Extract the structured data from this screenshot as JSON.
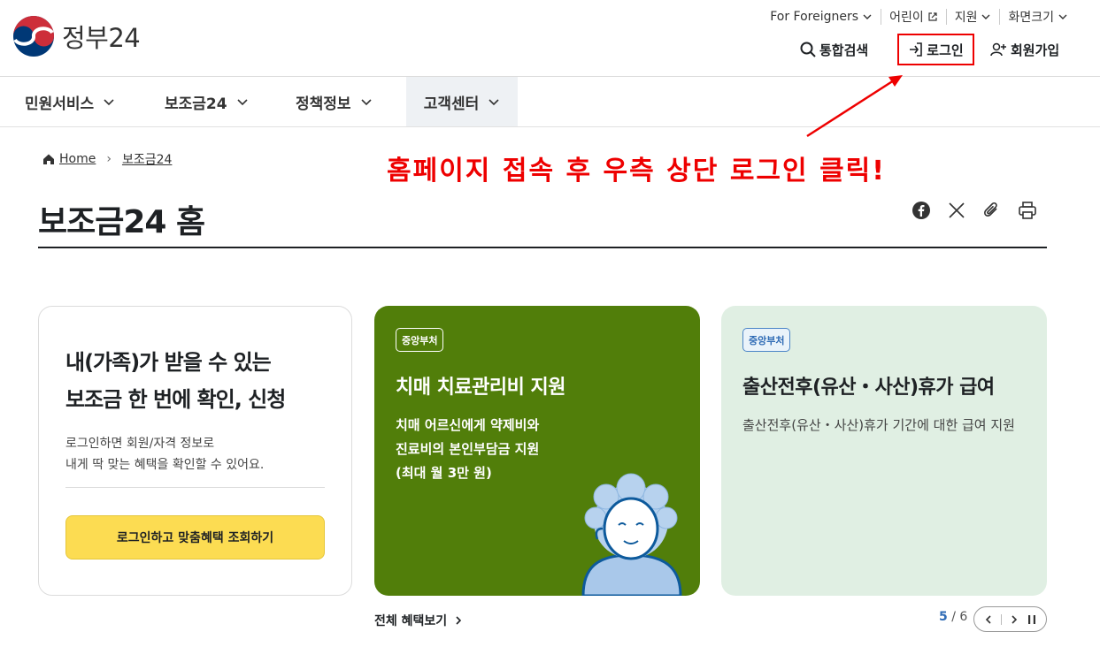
{
  "header": {
    "logo_text": "정부24",
    "util": [
      "For Foreigners",
      "어린이",
      "지원",
      "화면크기"
    ],
    "search_label": "통합검색",
    "login_label": "로그인",
    "join_label": "회원가입"
  },
  "gnb": [
    "민원서비스",
    "보조금24",
    "정책정보",
    "고객센터"
  ],
  "breadcrumb": {
    "home": "Home",
    "current": "보조금24"
  },
  "annotation": "홈페이지 접속 후 우측 상단 로그인 클릭!",
  "page_title": "보조금24 홈",
  "intro_card": {
    "heading": "내(가족)가 받을 수 있는\n보조금 한 번에 확인, 신청",
    "desc": "로그인하면 회원/자격 정보로\n내게 딱 맞는 혜택을 확인할 수 있어요.",
    "button": "로그인하고 맞춤혜택 조회하기"
  },
  "cards": [
    {
      "badge": "중앙부처",
      "title": "치매 치료관리비 지원",
      "desc": "치매 어르신에게 약제비와\n진료비의 본인부담금 지원\n(최대 월 3만 원)"
    },
    {
      "badge": "중앙부처",
      "title": "출산전후(유산・사산)휴가 급여",
      "desc": "출산전후(유산・사산)휴가 기간에 대한 급여 지원"
    }
  ],
  "more_label": "전체 혜택보기",
  "pager": {
    "current": "5",
    "total": "/ 6"
  },
  "colors": {
    "accent_red": "#ee0000",
    "green_card": "#517e0a",
    "mint_card": "#e0efe3",
    "yellow_button": "#fcdc52"
  }
}
